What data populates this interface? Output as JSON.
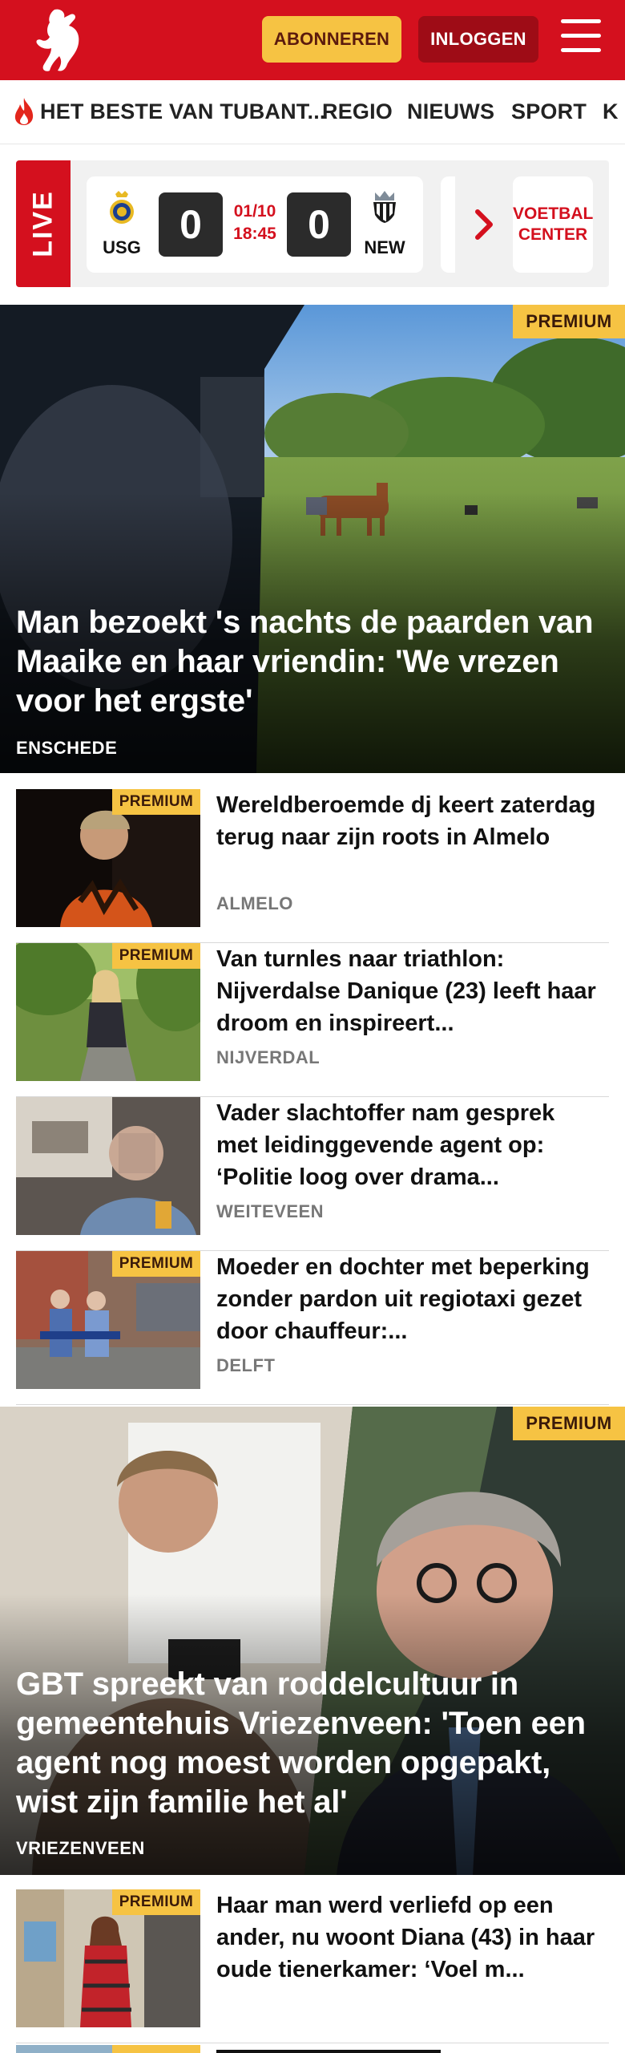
{
  "header": {
    "subscribe_label": "ABONNEREN",
    "login_label": "INLOGGEN",
    "brand_color": "#d4101e",
    "accent_color": "#f6c343"
  },
  "nav": {
    "items": [
      {
        "label": "HET BESTE VAN TUBANT...",
        "icon": "flame-icon"
      },
      {
        "label": "REGIO"
      },
      {
        "label": "NIEUWS"
      },
      {
        "label": "SPORT"
      },
      {
        "label": "K"
      }
    ]
  },
  "live": {
    "tag": "LIVE",
    "match": {
      "home": "USG",
      "away": "NEW",
      "home_score": "0",
      "away_score": "0",
      "date": "01/10",
      "time": "18:45"
    },
    "voetbal_center": "VOETBAL CENTER"
  },
  "premium_label": "PREMIUM",
  "articles": {
    "hero1": {
      "title": "Man bezoekt 's nachts de paarden van Maaike en haar vriendin: 'We vrezen voor het ergste'",
      "location": "ENSCHEDE",
      "premium": true
    },
    "list1": [
      {
        "title": "Wereldberoemde dj keert zaterdag terug naar zijn roots in Almelo",
        "location": "ALMELO",
        "premium": true
      },
      {
        "title": "Van turnles naar triathlon: Nijverdalse Danique (23) leeft haar droom en inspireert...",
        "location": "NIJVERDAL",
        "premium": true
      },
      {
        "title": "Vader slachtoffer nam gesprek met leidinggevende agent op: ‘Politie loog over drama...",
        "location": "WEITEVEEN",
        "premium": false
      },
      {
        "title": "Moeder en dochter met beperking zonder pardon uit regiotaxi gezet door chauffeur:...",
        "location": "DELFT",
        "premium": true
      }
    ],
    "hero2": {
      "title": "GBT spreekt van roddelcultuur in gemeentehuis Vriezenveen: 'Toen een agent nog moest worden opgepakt, wist zijn familie het al'",
      "location": "VRIEZENVEEN",
      "premium": true
    },
    "list2": [
      {
        "title": "Haar man werd verliefd op een ander, nu woont Diana (43) in haar oude tienerkamer: ‘Voel m...",
        "location": "",
        "premium": true
      }
    ]
  }
}
